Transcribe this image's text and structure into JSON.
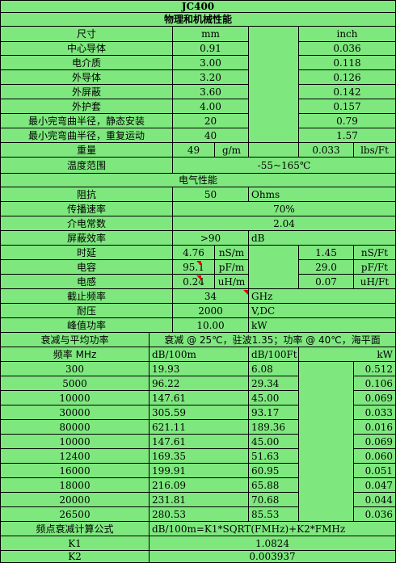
{
  "title": "JC400",
  "section_physical": "物理和机械性能",
  "section_electrical": "电气性能",
  "phys_header": {
    "label": "尺寸",
    "unit_mm": "mm",
    "unit_inch": "inch"
  },
  "physical": [
    {
      "label": "中心导体",
      "mm": "0.91",
      "inch": "0.036"
    },
    {
      "label": "电介质",
      "mm": "3.00",
      "inch": "0.118"
    },
    {
      "label": "外导体",
      "mm": "3.20",
      "inch": "0.126"
    },
    {
      "label": "外屏蔽",
      "mm": "3.60",
      "inch": "0.142"
    },
    {
      "label": "外护套",
      "mm": "4.00",
      "inch": "0.157"
    },
    {
      "label": "最小完弯曲半径，静态安装",
      "mm": "20",
      "inch": "0.79"
    },
    {
      "label": "最小完弯曲半径，重复运动",
      "mm": "40",
      "inch": "1.57"
    }
  ],
  "weight": {
    "label": "重量",
    "v1": "49",
    "u1": "g/m",
    "v2": "0.033",
    "u2": "lbs/Ft"
  },
  "temp": {
    "label": "温度范围",
    "value": "-55~165℃"
  },
  "impedance": {
    "label": "阻抗",
    "value": "50",
    "unit": "Ohms"
  },
  "velocity": {
    "label": "传播速率",
    "value": "70%"
  },
  "dielectric": {
    "label": "介电常数",
    "value": "2.04"
  },
  "shielding": {
    "label": "屏蔽效率",
    "value": ">90",
    "unit": "dB"
  },
  "pairs": [
    {
      "label": "时延",
      "v1": "4.76",
      "u1": "nS/m",
      "v2": "1.45",
      "u2": "nS/Ft"
    },
    {
      "label": "电容",
      "v1": "95.1",
      "u1": "pF/m",
      "v2": "29.0",
      "u2": "pF/Ft"
    },
    {
      "label": "电感",
      "v1": "0.24",
      "u1": "uH/m",
      "v2": "0.07",
      "u2": "uH/Ft"
    }
  ],
  "cutoff": {
    "label": "截止频率",
    "value": "34",
    "unit": "GHz"
  },
  "voltage": {
    "label": "耐压",
    "value": "2000",
    "unit": "V,DC"
  },
  "peak": {
    "label": "峰值功率",
    "value": "10.00",
    "unit": "kW"
  },
  "atten_header": {
    "label": "衰减与平均功率",
    "note": "衰减 @ 25℃，驻波1.35；功率 @ 40℃，海平面"
  },
  "freq_header": {
    "label": "频率 MHz",
    "c1": "dB/100m",
    "c2": "dB/100Ft",
    "c3": "kW"
  },
  "atten_rows": [
    {
      "f": "300",
      "a": "19.93",
      "b": "6.08",
      "p": "0.512"
    },
    {
      "f": "5000",
      "a": "96.22",
      "b": "29.34",
      "p": "0.106"
    },
    {
      "f": "10000",
      "a": "147.61",
      "b": "45.00",
      "p": "0.069"
    },
    {
      "f": "30000",
      "a": "305.59",
      "b": "93.17",
      "p": "0.033"
    },
    {
      "f": "80000",
      "a": "621.11",
      "b": "189.36",
      "p": "0.016"
    },
    {
      "f": "10000",
      "a": "147.61",
      "b": "45.00",
      "p": "0.069"
    },
    {
      "f": "12400",
      "a": "169.35",
      "b": "51.63",
      "p": "0.060"
    },
    {
      "f": "16000",
      "a": "199.91",
      "b": "60.95",
      "p": "0.051"
    },
    {
      "f": "18000",
      "a": "216.09",
      "b": "65.88",
      "p": "0.047"
    },
    {
      "f": "20000",
      "a": "231.81",
      "b": "70.68",
      "p": "0.044"
    },
    {
      "f": "26500",
      "a": "280.53",
      "b": "85.53",
      "p": "0.036"
    }
  ],
  "formula": {
    "label": "频点衰减计算公式",
    "value": "dB/100m=K1*SQRT(FMHz)+K2*FMHz"
  },
  "k1": {
    "label": "K1",
    "value": "1.0824"
  },
  "k2": {
    "label": "K2",
    "value": "0.003937"
  },
  "colors": {
    "background": "#7ee87e",
    "grid": "#000000",
    "comment_marker": "#e00000"
  }
}
